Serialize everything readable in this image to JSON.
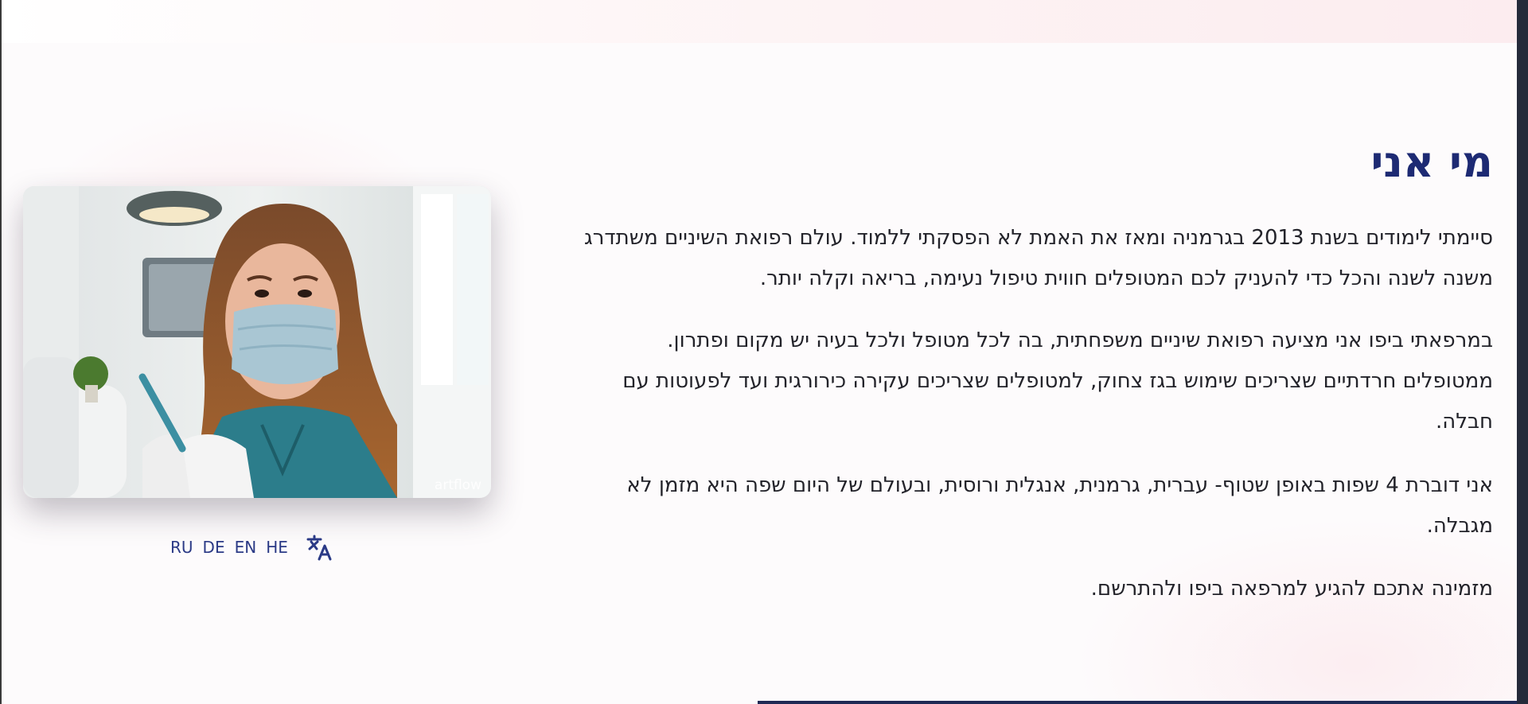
{
  "about": {
    "title": "מי אני",
    "paragraphs": [
      "סיימתי לימודים בשנת 2013 בגרמניה ומאז את האמת לא הפסקתי ללמוד. עולם רפואת השיניים משתדרג משנה לשנה והכל כדי להעניק לכם המטופלים חווית טיפול נעימה, בריאה וקלה יותר.",
      "במרפאתי ביפו אני מציעה רפואת שיניים משפחתית, בה לכל מטופל ולכל בעיה יש מקום ופתרון. ממטופלים חרדתיים שצריכים שימוש בגז צחוק, למטופלים שצריכים עקירה כירורגית ועד לפעוטות עם חבלה.",
      "אני דוברת 4 שפות באופן שטוף- עברית, גרמנית, אנגלית ורוסית, ובעולם של היום שפה היא מזמן לא מגבלה.",
      "מזמינה אתכם להגיע למרפאה ביפו ולהתרשם."
    ]
  },
  "photo": {
    "watermark": "artflow"
  },
  "language_switcher": {
    "languages": [
      "RU",
      "DE",
      "EN",
      "HE"
    ],
    "icon": "translate-icon"
  },
  "colors": {
    "title": "#1d2a73",
    "language_links": "#2b3a86",
    "body_text": "#23232a"
  }
}
